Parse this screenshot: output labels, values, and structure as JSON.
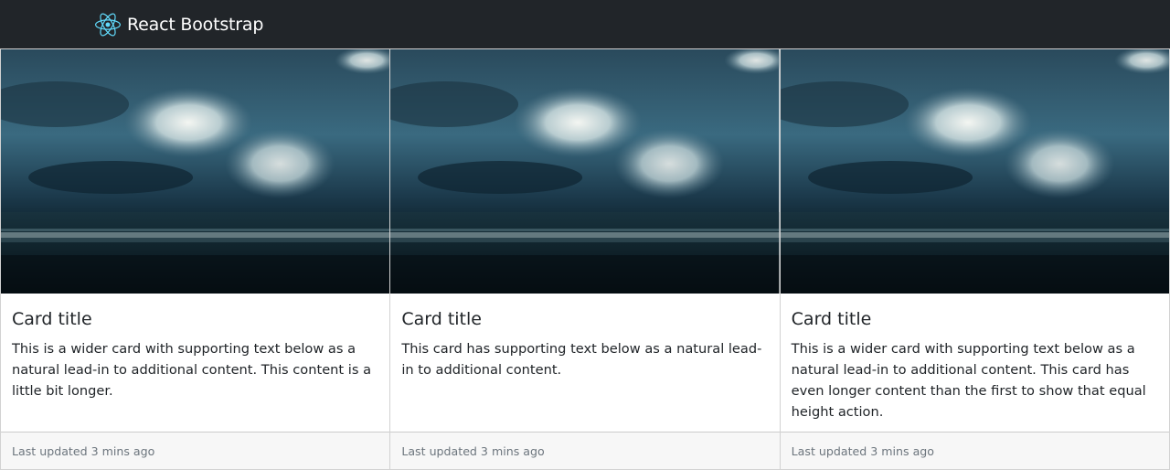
{
  "navbar": {
    "brand_text": "React Bootstrap",
    "logo_icon": "react-atom-icon",
    "logo_color": "#61dafb",
    "background": "#212529"
  },
  "cards": [
    {
      "image_icon": "ocean-sky-image",
      "title": "Card title",
      "text": "This is a wider card with supporting text below as a natural lead-in to additional content. This content is a little bit longer.",
      "footer": "Last updated 3 mins ago"
    },
    {
      "image_icon": "ocean-sky-image",
      "title": "Card title",
      "text": "This card has supporting text below as a natural lead-in to additional content.",
      "footer": "Last updated 3 mins ago"
    },
    {
      "image_icon": "ocean-sky-image",
      "title": "Card title",
      "text": "This is a wider card with supporting text below as a natural lead-in to additional content. This card has even longer content than the first to show that equal height action.",
      "footer": "Last updated 3 mins ago"
    }
  ]
}
